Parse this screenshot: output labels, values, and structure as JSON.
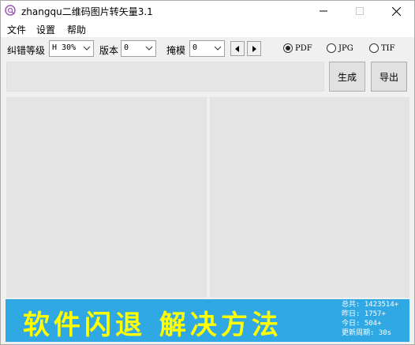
{
  "window": {
    "title": "zhangqu二维码图片转矢量3.1"
  },
  "menu": {
    "items": [
      "文件",
      "设置",
      "帮助"
    ]
  },
  "toolbar": {
    "error_level_label": "纠错等级",
    "error_level_value": "H 30%",
    "version_label": "版本",
    "version_value": "0",
    "mask_label": "掩模",
    "mask_value": "0",
    "formats": [
      {
        "label": "PDF",
        "selected": true
      },
      {
        "label": "JPG",
        "selected": false
      },
      {
        "label": "TIF",
        "selected": false
      }
    ]
  },
  "actions": {
    "generate_label": "生成",
    "export_label": "导出"
  },
  "banner": {
    "headline": "软件闪退  解决方法",
    "stats": {
      "total": "总共: 1423514+",
      "yesterday": "昨日: 1757+",
      "today": "今日: 504+",
      "period": "更新周期: 30s"
    }
  },
  "colors": {
    "banner_bg": "#2fa8e3",
    "banner_text": "#ffff00",
    "panel_bg": "#e4e4e4"
  }
}
